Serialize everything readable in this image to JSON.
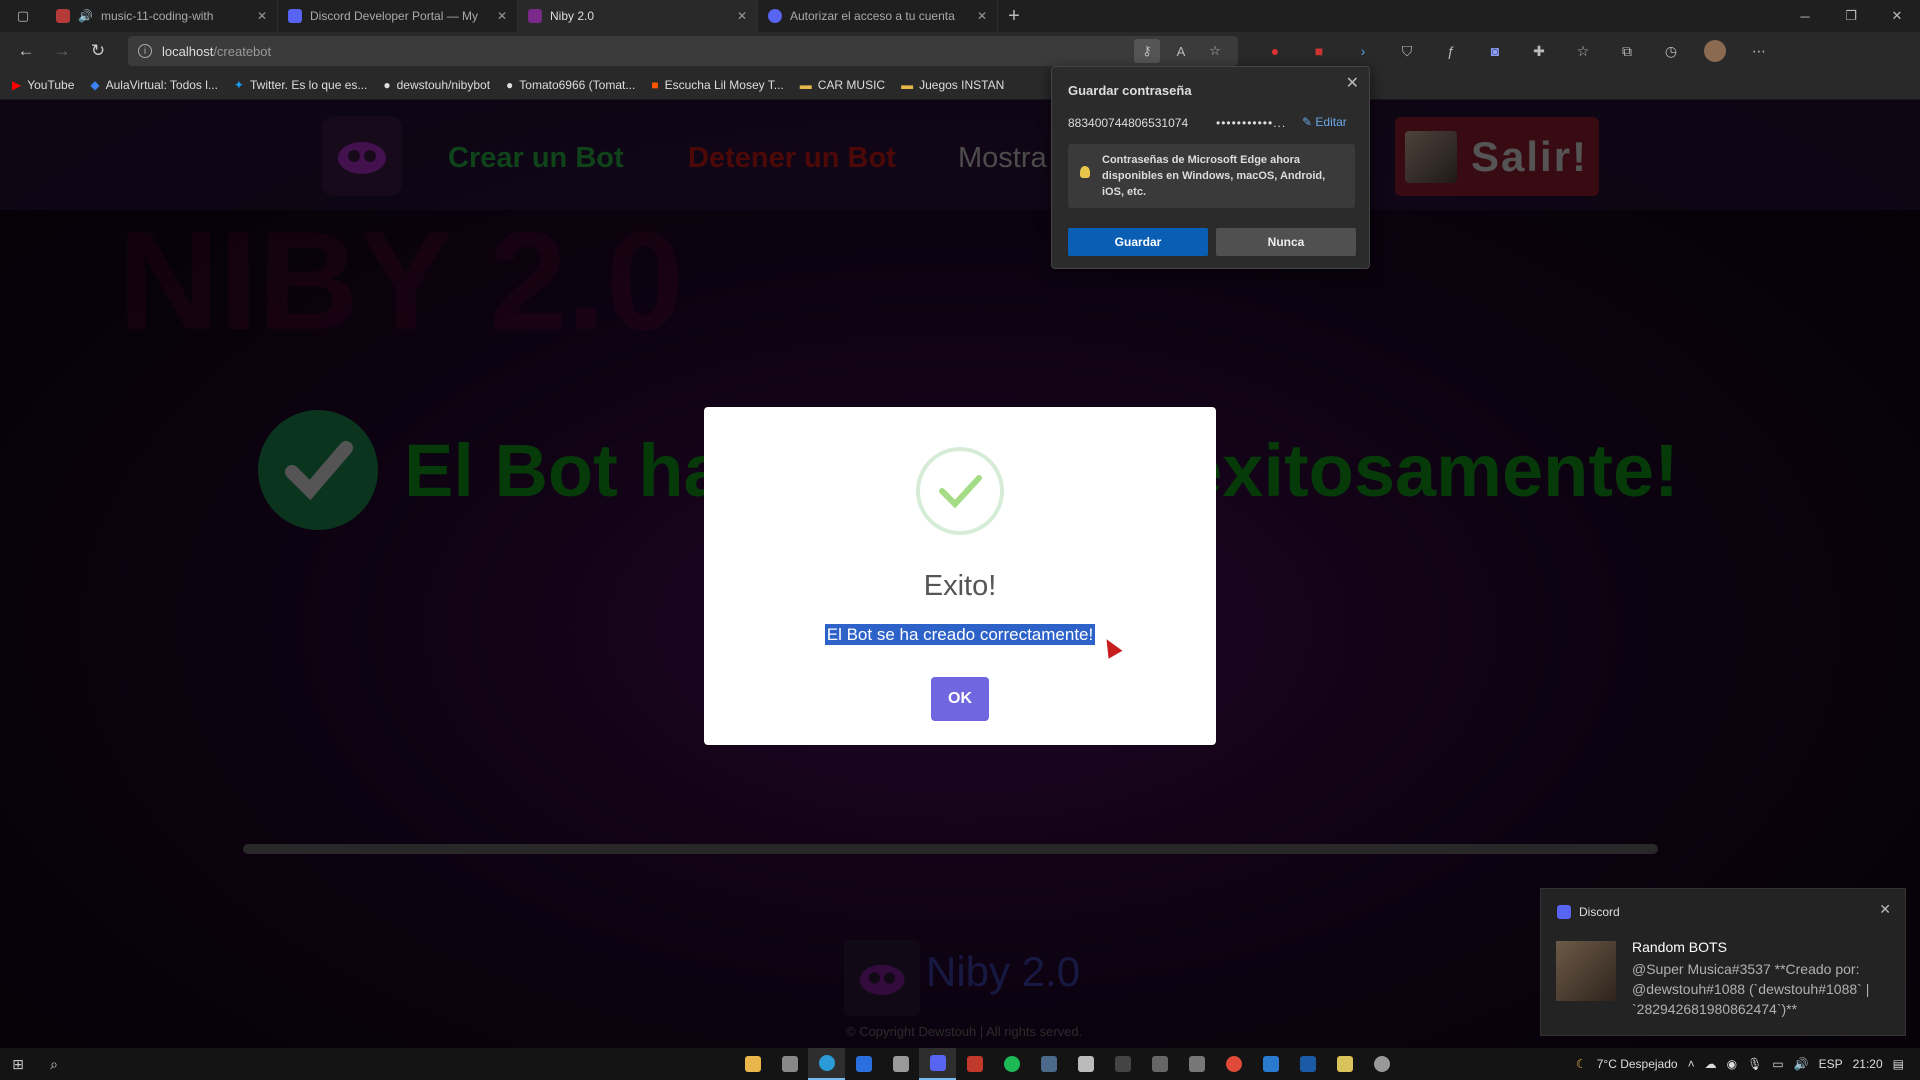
{
  "browser": {
    "tabs": [
      {
        "title": "music-11-coding-with",
        "favicon_color": "#5865f2",
        "badge": "173",
        "active": false
      },
      {
        "title": "Discord Developer Portal — My",
        "favicon_color": "#5865f2",
        "active": false
      },
      {
        "title": "Niby 2.0",
        "favicon_color": "#7a2a8a",
        "active": true
      },
      {
        "title": "Autorizar el acceso a tu cuenta",
        "favicon_color": "#5865f2",
        "active": false
      }
    ],
    "url_host": "localhost",
    "url_path": "/createbot",
    "bookmarks": [
      {
        "label": "YouTube",
        "icon": "youtube-icon",
        "color": "#ff0000"
      },
      {
        "label": "AulaVirtual: Todos l...",
        "icon": "aula-icon",
        "color": "#3b82f6"
      },
      {
        "label": "Twitter. Es lo que es...",
        "icon": "twitter-icon",
        "color": "#1d9bf0"
      },
      {
        "label": "dewstouh/nibybot",
        "icon": "github-icon",
        "color": "#dddddd"
      },
      {
        "label": "Tomato6966 (Tomat...",
        "icon": "github-icon",
        "color": "#dddddd"
      },
      {
        "label": "Escucha Lil Mosey T...",
        "icon": "soundcloud-icon",
        "color": "#ff5500"
      },
      {
        "label": "CAR MUSIC",
        "icon": "folder-icon",
        "color": "#e8b64b"
      },
      {
        "label": "Juegos INSTAN",
        "icon": "folder-icon",
        "color": "#e8b64b"
      }
    ]
  },
  "site": {
    "nav": {
      "create": "Crear un Bot",
      "stop": "Detener un Bot",
      "show": "Mostra"
    },
    "logout_label": "Salir!",
    "bg_title": "NIBY 2.0",
    "success_message": "El Bot ha sido creado exitosamente!",
    "footer_brand": "Niby 2.0",
    "footer_copyright": "© Copyright Dewstouh | All rights served."
  },
  "modal": {
    "title": "Exito!",
    "text": "El Bot se ha creado correctamente!",
    "ok_label": "OK",
    "accent": "#7066e0"
  },
  "password_popup": {
    "title": "Guardar contraseña",
    "username": "883400744806531074",
    "password_mask": "•••••••••••...",
    "edit_label": "Editar",
    "tip": "Contraseñas de Microsoft Edge ahora disponibles en Windows, macOS, Android, iOS, etc.",
    "save_label": "Guardar",
    "never_label": "Nunca"
  },
  "toast": {
    "app": "Discord",
    "title": "Random BOTS",
    "body": "@Super Musica#3537 **Creado por: @dewstouh#1088 (`dewstouh#1088` | `282942681980862474`)**"
  },
  "taskbar": {
    "weather": "7°C  Despejado",
    "lang": "ESP",
    "time": "21:20"
  }
}
